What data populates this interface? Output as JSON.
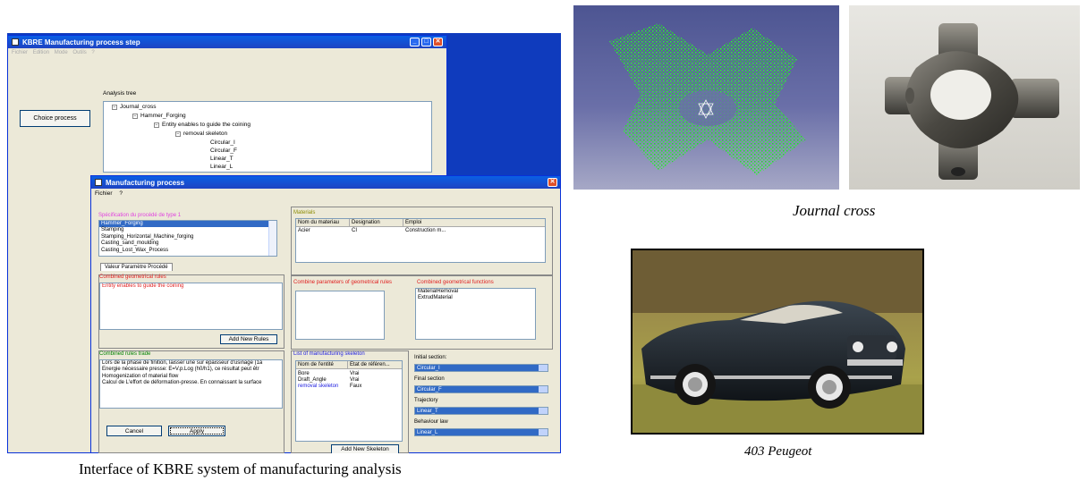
{
  "kbre_window": {
    "title": "KBRE Manufacturing process step",
    "menu": [
      "Fichier",
      "Edition",
      "Mode",
      "Outils",
      "?"
    ],
    "choice_button": "Choice process",
    "analysis_tree_label": "Analysis tree",
    "tree": [
      "Journal_cross",
      "Hammer_Forging",
      "Entity enables to guide the coining",
      "removal skeleton",
      "Circular_I",
      "Circular_F",
      "Linear_T",
      "Linear_L"
    ]
  },
  "mp_window": {
    "title": "Manufacturing process",
    "menu": [
      "Fichier",
      "?"
    ],
    "spec_label": "Spécification du procédé de type 1",
    "process_list": [
      "Hammer_Forging",
      "Stamping",
      "Stamping_Horizontal_Machine_forging",
      "Casting_sand_moulding",
      "Casting_Lost_Wax_Process"
    ],
    "tab_label": "Valeur Paramètre Procédé",
    "materials": {
      "label": "Materials",
      "headers": [
        "Nom du materiau",
        "Designation",
        "Emploi"
      ],
      "row": [
        "Acier",
        "CI",
        "Construction m..."
      ]
    },
    "combined_rules_label": "Combined geometrical rules",
    "combined_rules_text": "Entity enables to guide the coining",
    "add_rules_button": "Add New Rules",
    "combine_params_label": "Combine parameters of geometrical rules",
    "combined_functions_label": "Combined geometrical functions",
    "combined_functions": [
      "MaterialRemoval",
      "ExtrudMaterial"
    ],
    "rules_trade_label": "Combined rules trade",
    "rules_trade_lines": [
      "Lors de la phase de finition, laisser une sur épaisseur d'usinage (1à",
      "Energie nécessaire presse: E=V.p.Log (h0/h1), ce résultat peut êtr",
      "Homogenization of material flow",
      "Calcul de L'effort de déformation-presse. En connaissant la surface"
    ],
    "skeleton_label": "List of manufacturing skeleton",
    "skeleton_headers": [
      "Nom de l'entité",
      "Etat de référen..."
    ],
    "skeleton_rows": [
      [
        "Bore",
        "Vrai"
      ],
      [
        "Draft_Angle",
        "Vrai"
      ],
      [
        "removal skeleton",
        "Faux"
      ]
    ],
    "add_skeleton_button": "Add New Skeleton",
    "initial_section_label": "Initial section:",
    "initial_section_value": "Circular_I",
    "final_section_label": "Final section",
    "final_section_value": "Circular_F",
    "trajectory_label": "Trajectory",
    "trajectory_value": "Linear_T",
    "behaviour_label": "Behaviour law",
    "behaviour_value": "Linear_L",
    "cancel_button": "Cancel",
    "apply_button": "Apply"
  },
  "captions": {
    "left": "Interface of KBRE system of manufacturing analysis",
    "journal": "Journal cross",
    "peugeot": "403 Peugeot"
  }
}
